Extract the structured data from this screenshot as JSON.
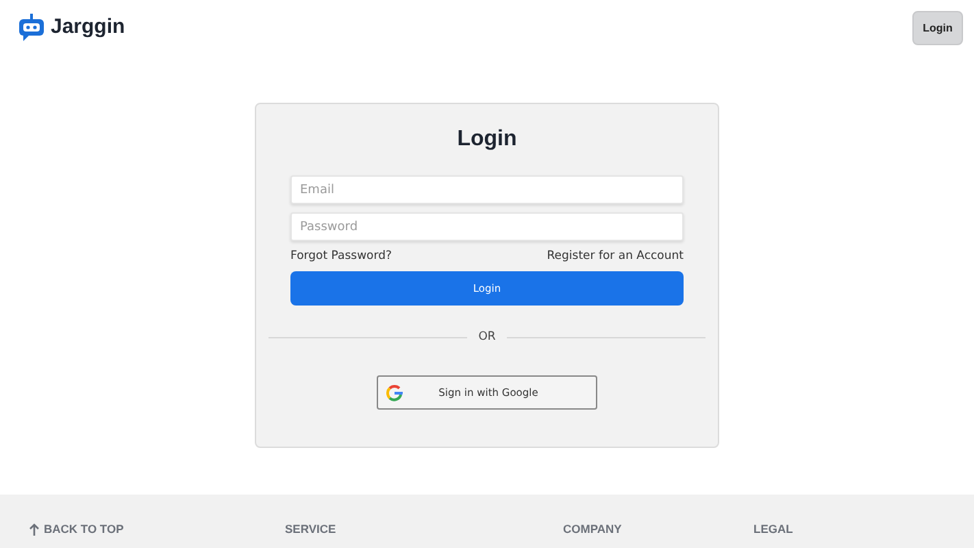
{
  "header": {
    "brand": "Jarggin",
    "login_button": "Login"
  },
  "login_card": {
    "title": "Login",
    "fields": [
      {
        "placeholder": "Email"
      },
      {
        "placeholder": "Password"
      }
    ],
    "forgot_link": "Forgot Password?",
    "register_link": "Register for an Account",
    "submit_button": "Login",
    "divider": "OR",
    "google_button": "Sign in with Google"
  },
  "footer": {
    "back_to_top": "BACK TO TOP",
    "columns": [
      "SERVICE",
      "COMPANY",
      "LEGAL"
    ]
  }
}
